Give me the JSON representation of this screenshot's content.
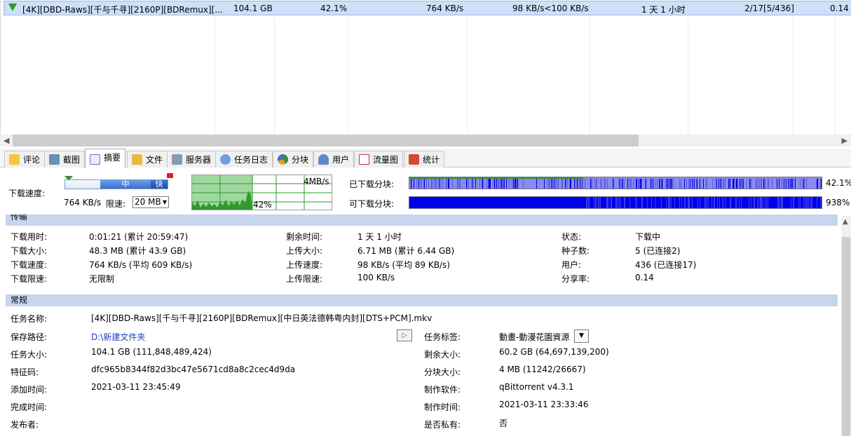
{
  "torrent_row": {
    "name": "[4K][DBD-Raws][千与千寻][2160P][BDRemux][...",
    "size": "104.1 GB",
    "progress": "42.1%",
    "down_speed": "764 KB/s",
    "up_speed": "98 KB/s<100 KB/s",
    "eta": "1 天 1 小时",
    "seeds": "2/17[5/436]",
    "ratio": "0.14"
  },
  "tabs": [
    {
      "label": "评论",
      "icon": "comment-icon"
    },
    {
      "label": "截图",
      "icon": "screenshot-icon"
    },
    {
      "label": "摘要",
      "icon": "summary-icon"
    },
    {
      "label": "文件",
      "icon": "files-icon"
    },
    {
      "label": "服务器",
      "icon": "server-icon"
    },
    {
      "label": "任务日志",
      "icon": "log-icon"
    },
    {
      "label": "分块",
      "icon": "pieces-icon"
    },
    {
      "label": "用户",
      "icon": "peers-icon"
    },
    {
      "label": "流量图",
      "icon": "traffic-graph-icon"
    },
    {
      "label": "统计",
      "icon": "stats-icon"
    }
  ],
  "speed": {
    "label": "下载速度:",
    "slider_mid": "中",
    "slider_fast": "快",
    "current": "764 KB/s",
    "limit_label": "限速:",
    "limit_value": "20 MB",
    "graph_scale": "4MB/s",
    "graph_percent": "42%",
    "downloaded_pieces_label": "已下载分块:",
    "downloaded_pieces_value": "42.1%",
    "available_pieces_label": "可下载分块:",
    "available_pieces_value": "938%",
    "downloaded_fraction": 0.421
  },
  "transfer": {
    "section": "传输",
    "rows": [
      [
        "下载用时:",
        "0:01:21 (累计 20:59:47)",
        "剩余时间:",
        "1 天 1 小时",
        "状态:",
        "下载中"
      ],
      [
        "下载大小:",
        "48.3 MB (累计 43.9 GB)",
        "上传大小:",
        "6.71 MB (累计 6.44 GB)",
        "种子数:",
        "5 (已连接2)"
      ],
      [
        "下载速度:",
        "764 KB/s (平均 609 KB/s)",
        "上传速度:",
        "98 KB/s (平均 89 KB/s)",
        "用户:",
        "436 (已连接17)"
      ],
      [
        "下载限速:",
        "无限制",
        "上传限速:",
        "100 KB/s",
        "分享率:",
        "0.14"
      ]
    ]
  },
  "general": {
    "section": "常规",
    "name_label": "任务名称:",
    "name_value": "[4K][DBD-Raws][千与千寻][2160P][BDRemux][中日英法德韩粤内封][DTS+PCM].mkv",
    "save_path_label": "保存路径:",
    "save_path_value": "D:\\新建文件夹",
    "tag_label": "任务标签:",
    "tag_value": "動畫-動漫花園資源",
    "size_label": "任务大小:",
    "size_value": "104.1 GB (111,848,489,424)",
    "remaining_label": "剩余大小:",
    "remaining_value": "60.2 GB (64,697,139,200)",
    "hash_label": "特征码:",
    "hash_value": "dfc965b8344f82d3bc47e5671cd8a8c2cec4d9da",
    "piece_label": "分块大小:",
    "piece_value": "4 MB (11242/26667)",
    "added_label": "添加时间:",
    "added_value": "2021-03-11 23:45:49",
    "software_label": "制作软件:",
    "software_value": "qBittorrent v4.3.1",
    "completed_label": "完成时间:",
    "completed_value": "",
    "created_label": "制作时间:",
    "created_value": "2021-03-11 23:33:46",
    "publisher_label": "发布者:",
    "publisher_value": "",
    "private_label": "是否私有:",
    "private_value": "否"
  },
  "colors": {
    "selection": "#cde0f7",
    "section_header": "#c7d5ee",
    "piece_blue": "#0000ee",
    "graph_green": "#2e9a2e"
  }
}
